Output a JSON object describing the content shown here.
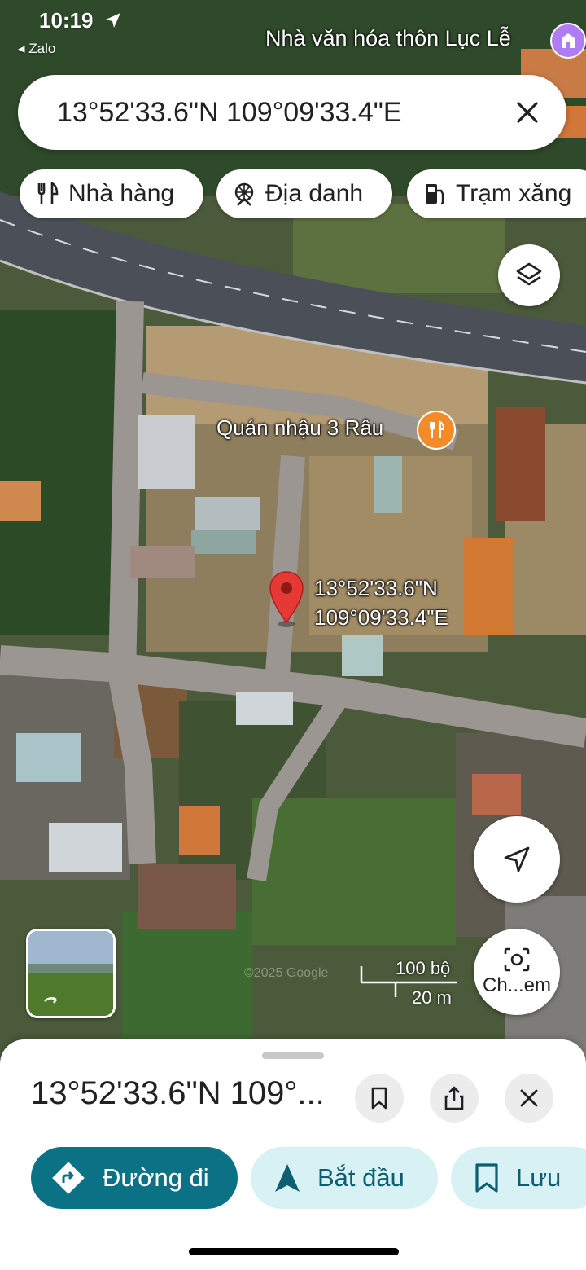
{
  "status": {
    "time": "10:19",
    "back_app": "◂ Zalo"
  },
  "map": {
    "top_place_label": "Nhà văn hóa thôn Lục Lễ",
    "restaurant_label": "Quán nhậu 3 Râu",
    "pin_label_line1": "13°52'33.6\"N",
    "pin_label_line2": "109°09'33.4\"E",
    "scale_imperial": "100 bộ",
    "scale_metric": "20 m",
    "watermark": "©2025 Google",
    "camera_label": "Ch...em"
  },
  "search": {
    "query": "13°52'33.6\"N 109°09'33.4\"E"
  },
  "chips": [
    {
      "label": "Nhà hàng",
      "icon": "restaurant-icon"
    },
    {
      "label": "Địa danh",
      "icon": "landmark-icon"
    },
    {
      "label": "Trạm xăng",
      "icon": "gas-station-icon"
    }
  ],
  "sheet": {
    "title": "13°52'33.6\"N 109°...",
    "actions": [
      {
        "label": "Đường đi",
        "icon": "directions-icon"
      },
      {
        "label": "Bắt đầu",
        "icon": "navigation-arrow-icon"
      },
      {
        "label": "Lưu",
        "icon": "bookmark-icon"
      }
    ]
  },
  "colors": {
    "pin_red": "#e53935",
    "primary_teal": "#0b7285",
    "secondary_bg": "#d8f1f5",
    "restaurant_orange": "#f28b28",
    "landmark_purple": "#b07cf5"
  }
}
